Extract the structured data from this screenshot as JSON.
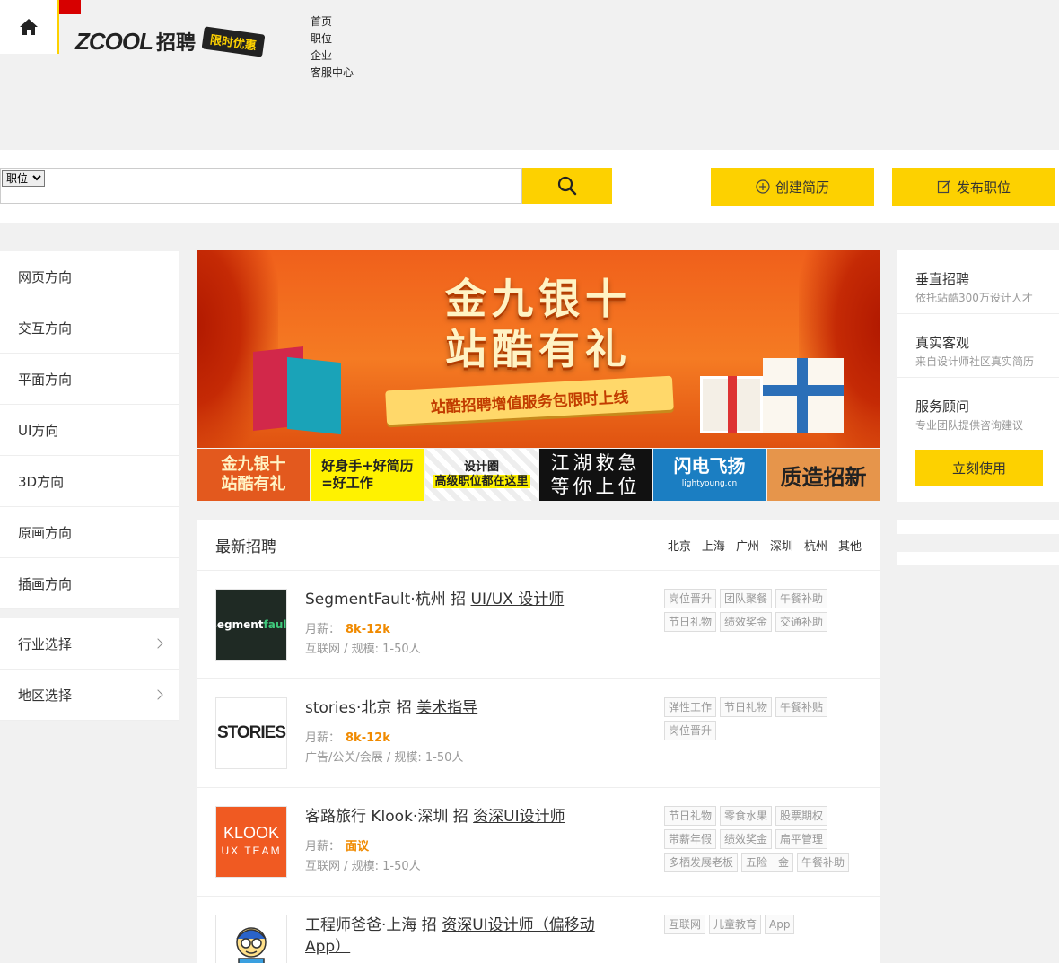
{
  "brand": {
    "logo_text": "ZCOOL",
    "logo_cn": "招聘",
    "promo_tag": "限时优惠"
  },
  "topnav": [
    "首页",
    "职位",
    "企业",
    "客服中心"
  ],
  "search": {
    "select_value": "职位",
    "placeholder": ""
  },
  "actions": {
    "create_resume": "创建简历",
    "post_job": "发布职位"
  },
  "left_menu": [
    "网页方向",
    "交互方向",
    "平面方向",
    "UI方向",
    "3D方向",
    "原画方向",
    "插画方向"
  ],
  "left_menu2": [
    "行业选择",
    "地区选择"
  ],
  "banner": {
    "title_line1": "金九银十",
    "title_line2": "站酷有礼",
    "ribbon": "站酷招聘增值服务包限时上线"
  },
  "thumbs": {
    "t1_line1": "金九银十",
    "t1_line2": "站酷有礼",
    "t2_line1": "好身手+好简历",
    "t2_line2": "=好工作",
    "t3_line1": "设计圈",
    "t3_line2": "高级职位都在这里",
    "t4_line1": "江湖救急",
    "t4_line2": "等你上位",
    "t5_line1": "闪电飞扬",
    "t5_line2": "lightyoung.cn",
    "t6": "质造招新"
  },
  "right_panel": {
    "items": [
      {
        "title": "垂直招聘",
        "subtitle": "依托站酷300万设计人才"
      },
      {
        "title": "真实客观",
        "subtitle": "来自设计师社区真实简历"
      },
      {
        "title": "服务顾问",
        "subtitle": "专业团队提供咨询建议"
      }
    ],
    "cta": "立刻使用"
  },
  "jobs": {
    "title": "最新招聘",
    "cities": [
      "北京",
      "上海",
      "广州",
      "深圳",
      "杭州",
      "其他"
    ],
    "salary_label": "月薪：",
    "list": [
      {
        "company_city": "SegmentFault·杭州 招 ",
        "position": "UI/UX 设计师",
        "salary": "8k-12k",
        "meta": "互联网 / 规模: 1-50人",
        "logo_text": "segment",
        "logo_text2": "fault",
        "tags": [
          "岗位晋升",
          "团队聚餐",
          "午餐补助",
          "节日礼物",
          "绩效奖金",
          "交通补助"
        ]
      },
      {
        "company_city": "stories·北京 招 ",
        "position": "美术指导",
        "salary": "8k-12k",
        "meta": "广告/公关/会展 / 规模: 1-50人",
        "logo_text": "STORIES",
        "tags": [
          "弹性工作",
          "节日礼物",
          "午餐补贴",
          "岗位晋升"
        ]
      },
      {
        "company_city": "客路旅行 Klook·深圳 招 ",
        "position": "资深UI设计师",
        "salary": "面议",
        "meta": "互联网 / 规模: 1-50人",
        "logo_text": "KLOOK",
        "logo_text2": "UX TEAM",
        "tags": [
          "节日礼物",
          "零食水果",
          "股票期权",
          "带薪年假",
          "绩效奖金",
          "扁平管理",
          "多栖发展老板",
          "五险一金",
          "午餐补助"
        ]
      },
      {
        "company_city": "工程师爸爸·上海 招 ",
        "position": "资深UI设计师（偏移动App）",
        "salary": "",
        "meta": "",
        "tags": [
          "互联网",
          "儿童教育",
          "App"
        ]
      }
    ]
  },
  "colors": {
    "accent": "#fdd100",
    "salary": "#f08a00",
    "brand_red": "#d70000"
  }
}
